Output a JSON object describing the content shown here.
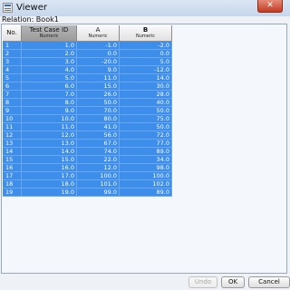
{
  "window": {
    "title": "Viewer",
    "close_glyph": "✕"
  },
  "relation_label": "Relation: Book1",
  "columns": [
    {
      "name": "No.",
      "type": ""
    },
    {
      "name": "Test Case ID",
      "type": "Numeric"
    },
    {
      "name": "A",
      "type": "Numeric"
    },
    {
      "name": "B",
      "type": "Numeric"
    }
  ],
  "rows": [
    [
      "1",
      "1.0",
      "-1.0",
      "-2.0"
    ],
    [
      "2",
      "2.0",
      "0.0",
      "0.0"
    ],
    [
      "3",
      "3.0",
      "-20.0",
      "5.0"
    ],
    [
      "4",
      "4.0",
      "9.0",
      "-12.0"
    ],
    [
      "5",
      "5.0",
      "11.0",
      "14.0"
    ],
    [
      "6",
      "6.0",
      "15.0",
      "30.0"
    ],
    [
      "7",
      "7.0",
      "26.0",
      "28.0"
    ],
    [
      "8",
      "8.0",
      "50.0",
      "40.0"
    ],
    [
      "9",
      "9.0",
      "70.0",
      "50.0"
    ],
    [
      "10",
      "10.0",
      "80.0",
      "75.0"
    ],
    [
      "11",
      "11.0",
      "41.0",
      "50.0"
    ],
    [
      "12",
      "12.0",
      "56.0",
      "72.0"
    ],
    [
      "13",
      "13.0",
      "67.0",
      "77.0"
    ],
    [
      "14",
      "14.0",
      "74.0",
      "89.0"
    ],
    [
      "15",
      "15.0",
      "22.0",
      "34.0"
    ],
    [
      "16",
      "16.0",
      "12.0",
      "98.0"
    ],
    [
      "17",
      "17.0",
      "100.0",
      "100.0"
    ],
    [
      "18",
      "18.0",
      "101.0",
      "102.0"
    ],
    [
      "19",
      "19.0",
      "99.0",
      "89.0"
    ]
  ],
  "buttons": {
    "undo": "Undo",
    "ok": "OK",
    "cancel": "Cancel"
  },
  "colors": {
    "selection": "#3d8eeb",
    "selected_header": "#a8a8a8",
    "titlebar": "#cfdcee"
  }
}
